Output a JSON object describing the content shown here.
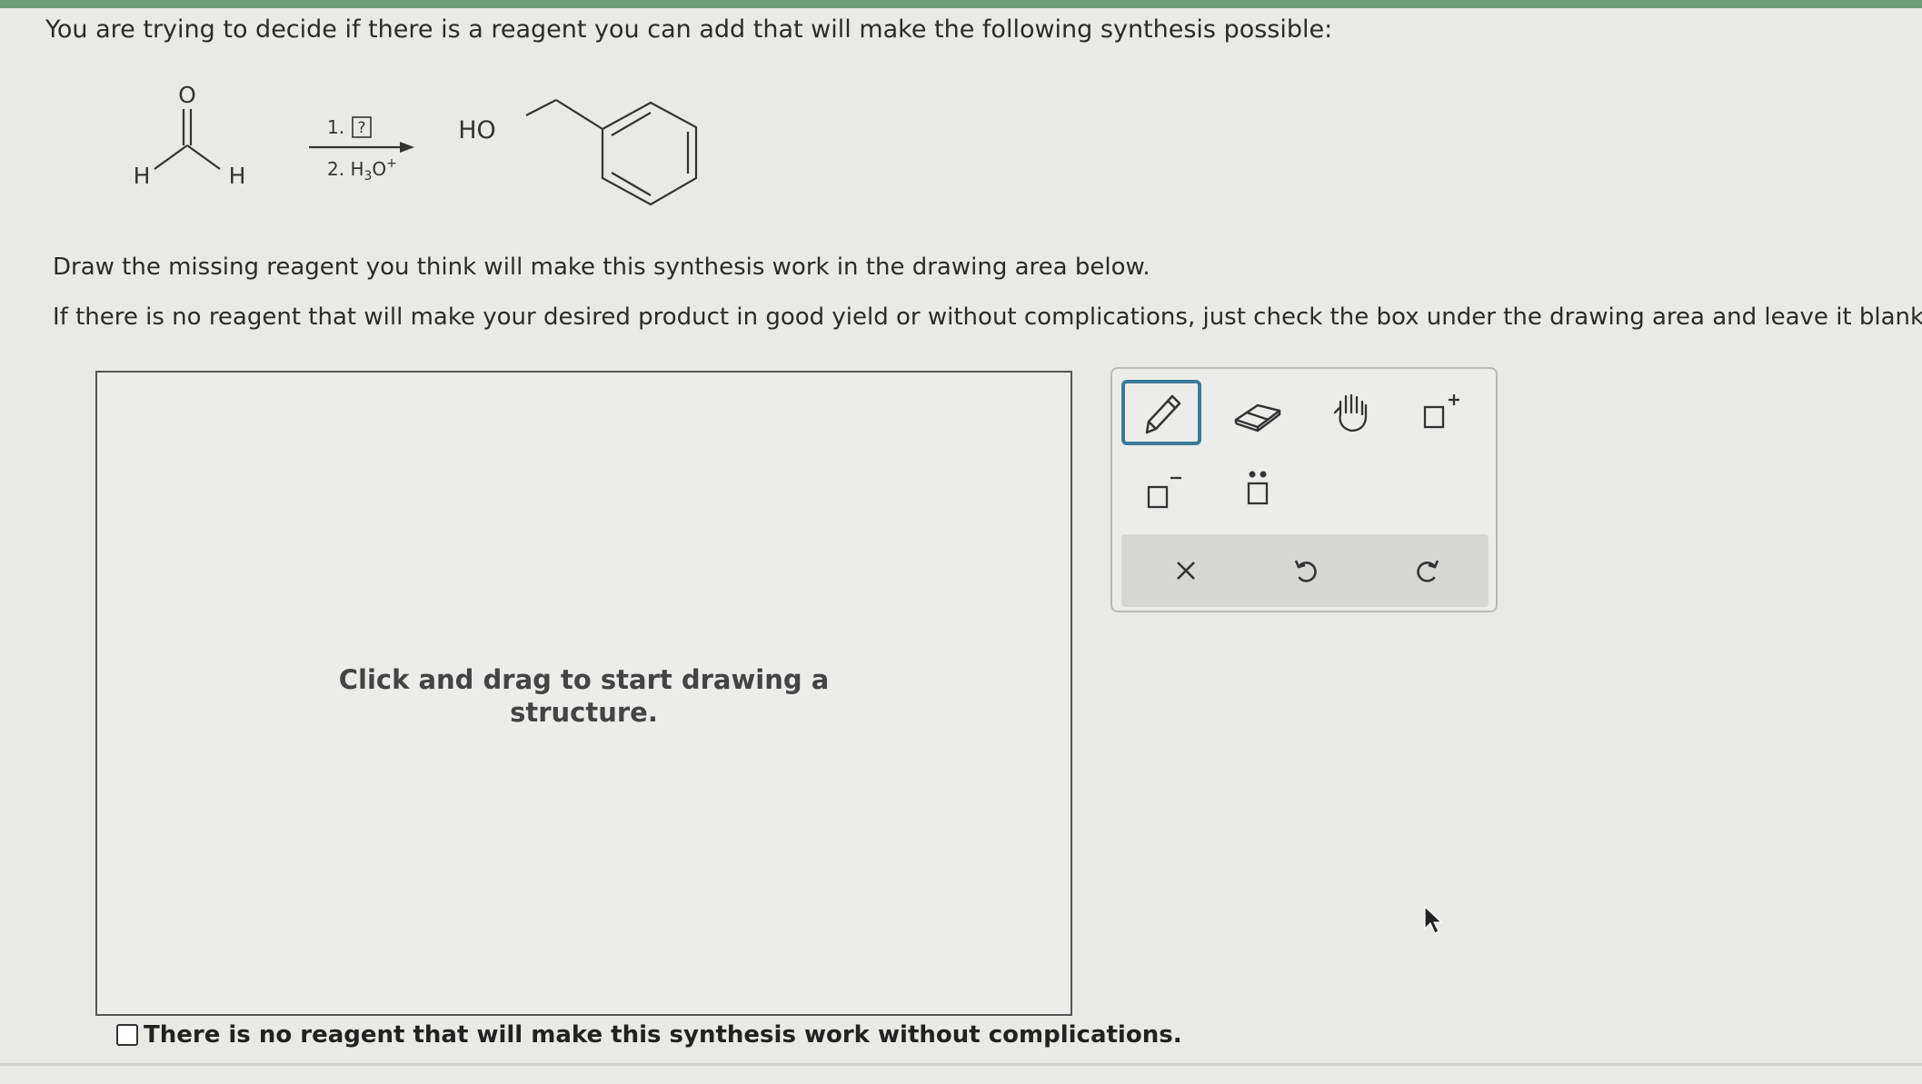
{
  "question": {
    "intro": "You are trying to decide if there is a reagent you can add that will make the following synthesis possible:",
    "instruction_1": "Draw the missing reagent you think will make this synthesis work in the drawing area below.",
    "instruction_2": "If there is no reagent that will make your desired product in good yield or without complications, just check the box under the drawing area and leave it blank."
  },
  "reaction": {
    "reactant_atoms": {
      "oxygen": "O",
      "hydrogen_left": "H",
      "hydrogen_right": "H"
    },
    "step_1": "1.",
    "step_1_unknown": "?",
    "step_2": "2. H",
    "step_2_sub": "3",
    "step_2_o": "O",
    "step_2_sup": "+",
    "product_group": "HO"
  },
  "canvas": {
    "hint_line_1": "Click and drag to start drawing a",
    "hint_line_2": "structure."
  },
  "toolbar": {
    "tools": [
      "pencil-icon",
      "eraser-icon",
      "hand-icon",
      "positive-charge-icon",
      "negative-charge-icon",
      "lone-pair-icon"
    ],
    "actions": [
      "clear-icon",
      "undo-icon",
      "redo-icon"
    ],
    "active_tool": "pencil-icon",
    "accent_color": "#3b7a99"
  },
  "no_reagent_option": {
    "label": "There is no reagent that will make this synthesis work without complications.",
    "checked": false
  }
}
